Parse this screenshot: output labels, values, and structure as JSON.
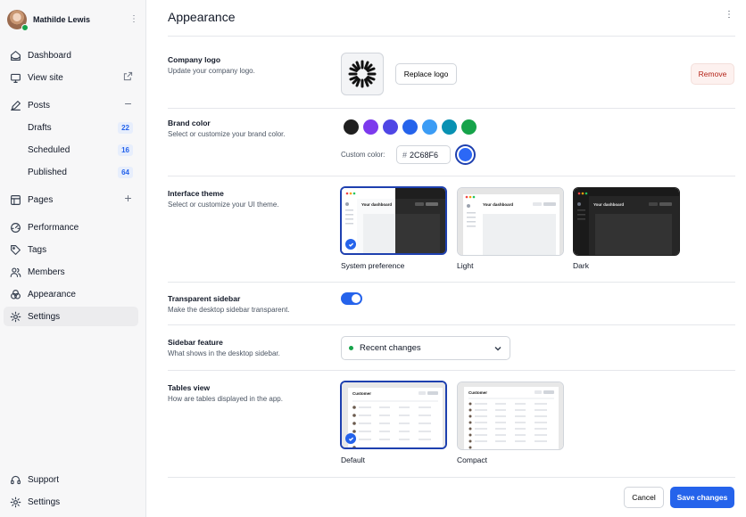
{
  "user": {
    "name": "Mathilde Lewis"
  },
  "sidebar": {
    "items": [
      {
        "label": "Dashboard",
        "icon": "home-icon"
      },
      {
        "label": "View site",
        "icon": "monitor-icon",
        "trailing": "external-link-icon"
      },
      {
        "label": "Posts",
        "icon": "pen-icon",
        "trailing": "minus-icon"
      },
      {
        "label": "Drafts",
        "count": "22"
      },
      {
        "label": "Scheduled",
        "count": "16"
      },
      {
        "label": "Published",
        "count": "64"
      },
      {
        "label": "Pages",
        "icon": "layout-icon",
        "trailing": "plus-icon"
      },
      {
        "label": "Performance",
        "icon": "gauge-icon"
      },
      {
        "label": "Tags",
        "icon": "tag-icon"
      },
      {
        "label": "Members",
        "icon": "users-icon"
      },
      {
        "label": "Appearance",
        "icon": "palette-icon"
      },
      {
        "label": "Settings",
        "icon": "gear-icon",
        "active": true
      }
    ],
    "bottom": [
      {
        "label": "Support",
        "icon": "lifebuoy-icon"
      },
      {
        "label": "Settings",
        "icon": "gear-icon"
      }
    ]
  },
  "page": {
    "title": "Appearance"
  },
  "logo_section": {
    "title": "Company logo",
    "desc": "Update your company logo.",
    "replace_label": "Replace logo",
    "remove_label": "Remove"
  },
  "brand_section": {
    "title": "Brand color",
    "desc": "Select or customize your brand color.",
    "swatches": [
      "#1f1f1f",
      "#7c3aed",
      "#4f46e5",
      "#2563eb",
      "#3b9cf5",
      "#0891b2",
      "#16a34a"
    ],
    "custom_label": "Custom color:",
    "hex_value": "2C68F6",
    "selected_color": "#2c68f6"
  },
  "theme_section": {
    "title": "Interface theme",
    "desc": "Select or customize your UI theme.",
    "options": [
      {
        "label": "System preference",
        "selected": true
      },
      {
        "label": "Light",
        "selected": false
      },
      {
        "label": "Dark",
        "selected": false
      }
    ],
    "preview_text": "Your dashboard"
  },
  "sidebar_section": {
    "title": "Transparent sidebar",
    "desc": "Make the desktop sidebar transparent.",
    "enabled": true
  },
  "feature_section": {
    "title": "Sidebar feature",
    "desc": "What shows in the desktop sidebar.",
    "selected": "Recent changes"
  },
  "tables_section": {
    "title": "Tables view",
    "desc": "How are tables displayed in the app.",
    "options": [
      {
        "label": "Default",
        "selected": true
      },
      {
        "label": "Compact",
        "selected": false
      }
    ],
    "preview_text": "Customer"
  },
  "footer": {
    "cancel_label": "Cancel",
    "save_label": "Save changes"
  },
  "colors": {
    "accent": "#2563eb",
    "danger": "#b42318",
    "success": "#16a34a"
  }
}
